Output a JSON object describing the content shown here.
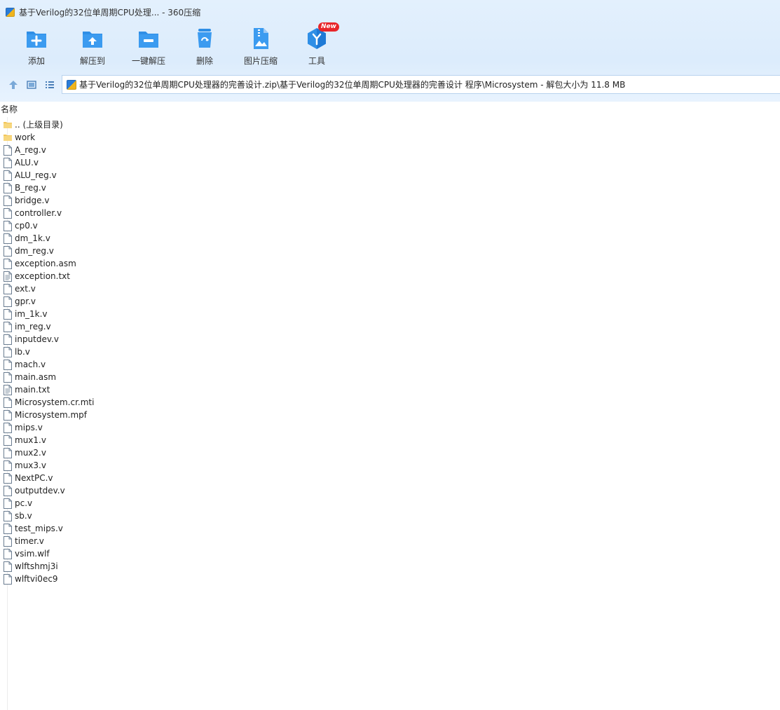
{
  "window": {
    "title": "基于Verilog的32位单周期CPU处理... - 360压缩"
  },
  "toolbar": {
    "items": [
      {
        "label": "添加",
        "icon": "add-icon"
      },
      {
        "label": "解压到",
        "icon": "extract-to-icon"
      },
      {
        "label": "一键解压",
        "icon": "one-click-extract-icon"
      },
      {
        "label": "删除",
        "icon": "delete-icon"
      },
      {
        "label": "图片压缩",
        "icon": "image-compress-icon"
      },
      {
        "label": "工具",
        "icon": "tools-icon",
        "badge": "New"
      }
    ]
  },
  "address": {
    "path": "基于Verilog的32位单周期CPU处理器的完善设计.zip\\基于Verilog的32位单周期CPU处理器的完善设计 程序\\Microsystem - 解包大小为 11.8 MB"
  },
  "list": {
    "column_name": "名称",
    "files": [
      {
        "name": ".. (上级目录)",
        "type": "folder"
      },
      {
        "name": "work",
        "type": "folder"
      },
      {
        "name": "A_reg.v",
        "type": "file"
      },
      {
        "name": "ALU.v",
        "type": "file"
      },
      {
        "name": "ALU_reg.v",
        "type": "file"
      },
      {
        "name": "B_reg.v",
        "type": "file"
      },
      {
        "name": "bridge.v",
        "type": "file"
      },
      {
        "name": "controller.v",
        "type": "file"
      },
      {
        "name": "cp0.v",
        "type": "file"
      },
      {
        "name": "dm_1k.v",
        "type": "file"
      },
      {
        "name": "dm_reg.v",
        "type": "file"
      },
      {
        "name": "exception.asm",
        "type": "file"
      },
      {
        "name": "exception.txt",
        "type": "text"
      },
      {
        "name": "ext.v",
        "type": "file"
      },
      {
        "name": "gpr.v",
        "type": "file"
      },
      {
        "name": "im_1k.v",
        "type": "file"
      },
      {
        "name": "im_reg.v",
        "type": "file"
      },
      {
        "name": "inputdev.v",
        "type": "file"
      },
      {
        "name": "lb.v",
        "type": "file"
      },
      {
        "name": "mach.v",
        "type": "file"
      },
      {
        "name": "main.asm",
        "type": "file"
      },
      {
        "name": "main.txt",
        "type": "text"
      },
      {
        "name": "Microsystem.cr.mti",
        "type": "file"
      },
      {
        "name": "Microsystem.mpf",
        "type": "file"
      },
      {
        "name": "mips.v",
        "type": "file"
      },
      {
        "name": "mux1.v",
        "type": "file"
      },
      {
        "name": "mux2.v",
        "type": "file"
      },
      {
        "name": "mux3.v",
        "type": "file"
      },
      {
        "name": "NextPC.v",
        "type": "file"
      },
      {
        "name": "outputdev.v",
        "type": "file"
      },
      {
        "name": "pc.v",
        "type": "file"
      },
      {
        "name": "sb.v",
        "type": "file"
      },
      {
        "name": "test_mips.v",
        "type": "file"
      },
      {
        "name": "timer.v",
        "type": "file"
      },
      {
        "name": "vsim.wlf",
        "type": "file"
      },
      {
        "name": "wlftshmj3i",
        "type": "file"
      },
      {
        "name": "wlftvi0ec9",
        "type": "file"
      }
    ]
  },
  "colors": {
    "accent": "#2f8fe6",
    "header_bg": "#e0eefc",
    "badge": "#e8262a"
  }
}
